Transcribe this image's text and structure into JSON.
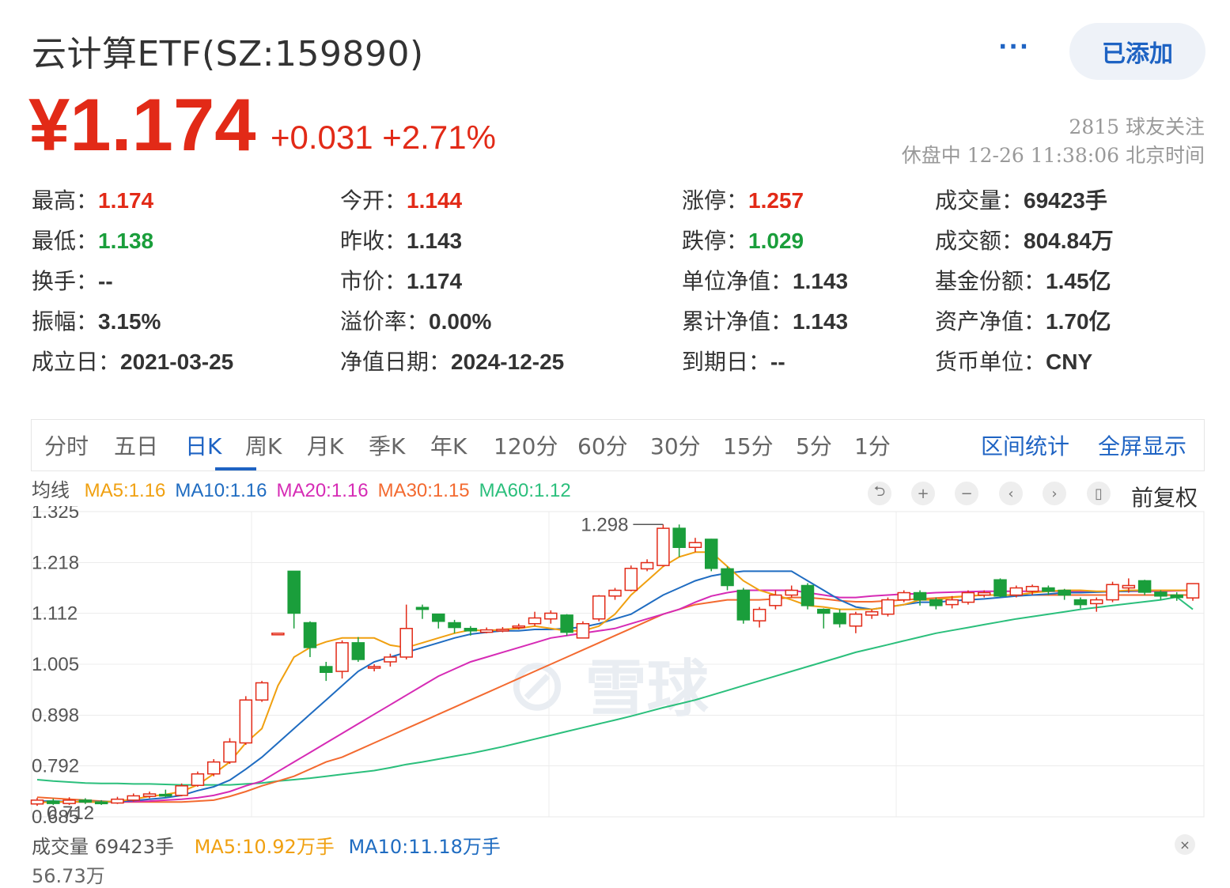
{
  "header": {
    "title": "云计算ETF(SZ:159890)",
    "more": "···",
    "added_button": "已添加",
    "price": "¥1.174",
    "change": "+0.031  +2.71%",
    "followers": "2815 球友关注",
    "status": "休盘中 12-26 11:38:06 北京时间"
  },
  "quote": {
    "col1": [
      {
        "label": "最高：",
        "value": "1.174",
        "tone": "up"
      },
      {
        "label": "最低：",
        "value": "1.138",
        "tone": "down"
      },
      {
        "label": "换手：",
        "value": "--",
        "tone": ""
      },
      {
        "label": "振幅：",
        "value": "3.15%",
        "tone": ""
      },
      {
        "label": "成立日：",
        "value": "2021-03-25",
        "tone": ""
      }
    ],
    "col2": [
      {
        "label": "今开：",
        "value": "1.144",
        "tone": "up"
      },
      {
        "label": "昨收：",
        "value": "1.143",
        "tone": ""
      },
      {
        "label": "市价：",
        "value": "1.174",
        "tone": ""
      },
      {
        "label": "溢价率：",
        "value": "0.00%",
        "tone": ""
      },
      {
        "label": "净值日期：",
        "value": "2024-12-25",
        "tone": ""
      }
    ],
    "col3": [
      {
        "label": "涨停：",
        "value": "1.257",
        "tone": "up"
      },
      {
        "label": "跌停：",
        "value": "1.029",
        "tone": "down"
      },
      {
        "label": "单位净值：",
        "value": "1.143",
        "tone": ""
      },
      {
        "label": "累计净值：",
        "value": "1.143",
        "tone": ""
      },
      {
        "label": "到期日：",
        "value": "--",
        "tone": ""
      }
    ],
    "col4": [
      {
        "label": "成交量：",
        "value": "69423手",
        "tone": ""
      },
      {
        "label": "成交额：",
        "value": "804.84万",
        "tone": ""
      },
      {
        "label": "基金份额：",
        "value": "1.45亿",
        "tone": ""
      },
      {
        "label": "资产净值：",
        "value": "1.70亿",
        "tone": ""
      },
      {
        "label": "货币单位：",
        "value": "CNY",
        "tone": ""
      }
    ]
  },
  "tabs": [
    "分时",
    "五日",
    "日K",
    "周K",
    "月K",
    "季K",
    "年K",
    "120分",
    "60分",
    "30分",
    "15分",
    "5分",
    "1分"
  ],
  "active_tab": "日K",
  "tab_actions": [
    "区间统计",
    "全屏显示"
  ],
  "ma_legend": {
    "label": "均线",
    "items": [
      {
        "text": "MA5:1.16",
        "color": "#f0a010"
      },
      {
        "text": "MA10:1.16",
        "color": "#1f6cc1"
      },
      {
        "text": "MA20:1.16",
        "color": "#d62bb5"
      },
      {
        "text": "MA30:1.15",
        "color": "#f36a30"
      },
      {
        "text": "MA60:1.12",
        "color": "#2bbf7c"
      }
    ]
  },
  "controls": {
    "icons": [
      "undo-icon",
      "zoom-in-icon",
      "zoom-out-icon",
      "left-icon",
      "right-icon",
      "candle-icon"
    ],
    "glyphs": [
      "⮌",
      "+",
      "−",
      "‹",
      "›",
      "▯"
    ],
    "adjust": "前复权"
  },
  "watermark": "雪球",
  "volume": {
    "label": "成交量 69423手",
    "ma5": "MA5:10.92万手",
    "ma10": "MA10:11.18万手",
    "close": "×",
    "cut_label": "56.73万"
  },
  "colors": {
    "up": "#e22a17",
    "down": "#1a9e3b",
    "accent": "#1e63c3"
  },
  "chart_data": {
    "type": "candlestick",
    "y_ticks": [
      "1.325",
      "1.218",
      "1.112",
      "1.005",
      "0.898",
      "0.792",
      "0.685"
    ],
    "ylim": [
      0.685,
      1.325
    ],
    "max_label": "1.298",
    "min_label": "0.712",
    "candles": [
      [
        0.712,
        0.72,
        0.725,
        0.708
      ],
      [
        0.718,
        0.713,
        0.723,
        0.71
      ],
      [
        0.713,
        0.72,
        0.726,
        0.71
      ],
      [
        0.72,
        0.716,
        0.724,
        0.712
      ],
      [
        0.716,
        0.714,
        0.72,
        0.71
      ],
      [
        0.714,
        0.722,
        0.727,
        0.712
      ],
      [
        0.72,
        0.729,
        0.734,
        0.717
      ],
      [
        0.728,
        0.733,
        0.738,
        0.724
      ],
      [
        0.732,
        0.73,
        0.742,
        0.726
      ],
      [
        0.73,
        0.75,
        0.755,
        0.728
      ],
      [
        0.751,
        0.775,
        0.78,
        0.748
      ],
      [
        0.775,
        0.8,
        0.806,
        0.77
      ],
      [
        0.8,
        0.842,
        0.85,
        0.796
      ],
      [
        0.84,
        0.93,
        0.938,
        0.836
      ],
      [
        0.93,
        0.966,
        0.97,
        0.926
      ],
      [
        1.07,
        1.07,
        1.07,
        1.07
      ],
      [
        1.2,
        1.112,
        1.2,
        1.08
      ],
      [
        1.092,
        1.04,
        1.095,
        1.02
      ],
      [
        1.0,
        0.988,
        1.01,
        0.97
      ],
      [
        0.99,
        1.05,
        1.055,
        0.975
      ],
      [
        1.05,
        1.015,
        1.062,
        1.01
      ],
      [
        1.0,
        1.0,
        1.005,
        0.99
      ],
      [
        1.01,
        1.02,
        1.027,
        1.0
      ],
      [
        1.02,
        1.08,
        1.13,
        1.015
      ],
      [
        1.124,
        1.12,
        1.13,
        1.1
      ],
      [
        1.11,
        1.095,
        1.11,
        1.08
      ],
      [
        1.092,
        1.082,
        1.098,
        1.07
      ],
      [
        1.08,
        1.075,
        1.085,
        1.065
      ],
      [
        1.072,
        1.077,
        1.082,
        1.07
      ],
      [
        1.076,
        1.078,
        1.083,
        1.072
      ],
      [
        1.082,
        1.085,
        1.09,
        1.078
      ],
      [
        1.09,
        1.102,
        1.115,
        1.085
      ],
      [
        1.1,
        1.112,
        1.118,
        1.09
      ],
      [
        1.108,
        1.072,
        1.11,
        1.065
      ],
      [
        1.06,
        1.09,
        1.095,
        1.06
      ],
      [
        1.1,
        1.148,
        1.15,
        1.095
      ],
      [
        1.148,
        1.16,
        1.165,
        1.14
      ],
      [
        1.16,
        1.206,
        1.212,
        1.158
      ],
      [
        1.205,
        1.218,
        1.225,
        1.2
      ],
      [
        1.212,
        1.29,
        1.298,
        1.21
      ],
      [
        1.29,
        1.25,
        1.298,
        1.23
      ],
      [
        1.25,
        1.26,
        1.27,
        1.24
      ],
      [
        1.267,
        1.206,
        1.268,
        1.2
      ],
      [
        1.205,
        1.17,
        1.21,
        1.16
      ],
      [
        1.16,
        1.098,
        1.165,
        1.09
      ],
      [
        1.096,
        1.12,
        1.125,
        1.082
      ],
      [
        1.128,
        1.15,
        1.16,
        1.12
      ],
      [
        1.15,
        1.16,
        1.17,
        1.145
      ],
      [
        1.17,
        1.128,
        1.175,
        1.12
      ],
      [
        1.12,
        1.112,
        1.122,
        1.08
      ],
      [
        1.112,
        1.09,
        1.12,
        1.082
      ],
      [
        1.085,
        1.11,
        1.115,
        1.07
      ],
      [
        1.108,
        1.115,
        1.12,
        1.1
      ],
      [
        1.11,
        1.14,
        1.145,
        1.105
      ],
      [
        1.14,
        1.155,
        1.16,
        1.135
      ],
      [
        1.155,
        1.14,
        1.16,
        1.128
      ],
      [
        1.14,
        1.128,
        1.145,
        1.12
      ],
      [
        1.13,
        1.14,
        1.148,
        1.122
      ],
      [
        1.135,
        1.155,
        1.16,
        1.13
      ],
      [
        1.15,
        1.155,
        1.16,
        1.145
      ],
      [
        1.182,
        1.148,
        1.185,
        1.145
      ],
      [
        1.15,
        1.165,
        1.17,
        1.145
      ],
      [
        1.158,
        1.168,
        1.172,
        1.15
      ],
      [
        1.165,
        1.158,
        1.17,
        1.15
      ],
      [
        1.16,
        1.15,
        1.163,
        1.14
      ],
      [
        1.14,
        1.13,
        1.145,
        1.122
      ],
      [
        1.132,
        1.14,
        1.145,
        1.115
      ],
      [
        1.14,
        1.172,
        1.178,
        1.135
      ],
      [
        1.165,
        1.17,
        1.185,
        1.155
      ],
      [
        1.18,
        1.156,
        1.182,
        1.15
      ],
      [
        1.156,
        1.148,
        1.16,
        1.14
      ],
      [
        1.15,
        1.145,
        1.156,
        1.138
      ],
      [
        1.144,
        1.174,
        1.174,
        1.138
      ]
    ],
    "ma5": [
      0.715,
      0.716,
      0.717,
      0.716,
      0.716,
      0.718,
      0.722,
      0.728,
      0.732,
      0.738,
      0.752,
      0.775,
      0.8,
      0.84,
      0.87,
      0.96,
      1.02,
      1.04,
      1.052,
      1.06,
      1.06,
      1.06,
      1.045,
      1.04,
      1.05,
      1.06,
      1.07,
      1.077,
      1.075,
      1.078,
      1.08,
      1.085,
      1.08,
      1.075,
      1.075,
      1.085,
      1.11,
      1.15,
      1.18,
      1.21,
      1.23,
      1.24,
      1.24,
      1.21,
      1.18,
      1.16,
      1.15,
      1.14,
      1.128,
      1.125,
      1.12,
      1.12,
      1.12,
      1.125,
      1.13,
      1.14,
      1.14,
      1.145,
      1.148,
      1.15,
      1.15,
      1.15,
      1.155,
      1.158,
      1.16,
      1.16,
      1.158,
      1.158,
      1.16,
      1.16,
      1.16,
      1.16,
      1.16
    ],
    "ma10": [
      0.718,
      0.718,
      0.717,
      0.717,
      0.717,
      0.717,
      0.719,
      0.722,
      0.725,
      0.73,
      0.74,
      0.748,
      0.762,
      0.785,
      0.81,
      0.84,
      0.87,
      0.9,
      0.93,
      0.96,
      0.99,
      1.01,
      1.02,
      1.03,
      1.04,
      1.05,
      1.06,
      1.068,
      1.072,
      1.075,
      1.075,
      1.078,
      1.078,
      1.08,
      1.083,
      1.09,
      1.1,
      1.11,
      1.13,
      1.15,
      1.165,
      1.18,
      1.19,
      1.196,
      1.2,
      1.2,
      1.2,
      1.2,
      1.18,
      1.16,
      1.14,
      1.125,
      1.12,
      1.125,
      1.13,
      1.135,
      1.135,
      1.138,
      1.14,
      1.142,
      1.145,
      1.148,
      1.15,
      1.152,
      1.155,
      1.155,
      1.156,
      1.157,
      1.158,
      1.16,
      1.16,
      1.16,
      1.16
    ],
    "ma20": [
      0.716,
      0.716,
      0.716,
      0.716,
      0.716,
      0.716,
      0.717,
      0.718,
      0.72,
      0.722,
      0.725,
      0.73,
      0.738,
      0.75,
      0.76,
      0.78,
      0.8,
      0.82,
      0.84,
      0.86,
      0.88,
      0.9,
      0.92,
      0.94,
      0.96,
      0.98,
      0.995,
      1.01,
      1.02,
      1.03,
      1.04,
      1.05,
      1.06,
      1.065,
      1.07,
      1.075,
      1.08,
      1.09,
      1.1,
      1.11,
      1.12,
      1.135,
      1.148,
      1.155,
      1.16,
      1.16,
      1.16,
      1.16,
      1.155,
      1.15,
      1.145,
      1.145,
      1.148,
      1.15,
      1.152,
      1.153,
      1.155,
      1.156,
      1.157,
      1.158,
      1.158,
      1.158,
      1.158,
      1.158,
      1.158,
      1.158,
      1.157,
      1.157,
      1.158,
      1.158,
      1.158,
      1.159,
      1.16
    ],
    "ma30": [
      0.726,
      0.724,
      0.722,
      0.72,
      0.718,
      0.716,
      0.716,
      0.716,
      0.716,
      0.716,
      0.718,
      0.72,
      0.728,
      0.738,
      0.75,
      0.76,
      0.77,
      0.785,
      0.8,
      0.81,
      0.825,
      0.84,
      0.855,
      0.87,
      0.885,
      0.9,
      0.915,
      0.93,
      0.945,
      0.96,
      0.975,
      0.99,
      1.005,
      1.02,
      1.035,
      1.05,
      1.065,
      1.08,
      1.095,
      1.11,
      1.12,
      1.13,
      1.135,
      1.14,
      1.14,
      1.14,
      1.142,
      1.145,
      1.145,
      1.142,
      1.138,
      1.136,
      1.136,
      1.138,
      1.14,
      1.142,
      1.144,
      1.146,
      1.148,
      1.15,
      1.15,
      1.15,
      1.15,
      1.15,
      1.15,
      1.15,
      1.15,
      1.15,
      1.15,
      1.15,
      1.15,
      1.15,
      1.15
    ],
    "ma60": [
      0.763,
      0.76,
      0.758,
      0.756,
      0.755,
      0.755,
      0.754,
      0.754,
      0.753,
      0.752,
      0.752,
      0.752,
      0.752,
      0.754,
      0.756,
      0.76,
      0.763,
      0.766,
      0.77,
      0.774,
      0.778,
      0.782,
      0.788,
      0.795,
      0.8,
      0.806,
      0.812,
      0.818,
      0.825,
      0.832,
      0.84,
      0.848,
      0.856,
      0.864,
      0.872,
      0.88,
      0.888,
      0.896,
      0.905,
      0.914,
      0.922,
      0.93,
      0.94,
      0.95,
      0.96,
      0.97,
      0.98,
      0.99,
      1.0,
      1.01,
      1.02,
      1.03,
      1.038,
      1.046,
      1.054,
      1.062,
      1.07,
      1.076,
      1.082,
      1.088,
      1.094,
      1.1,
      1.105,
      1.11,
      1.115,
      1.12,
      1.124,
      1.128,
      1.132,
      1.136,
      1.14,
      1.146,
      1.12
    ]
  }
}
